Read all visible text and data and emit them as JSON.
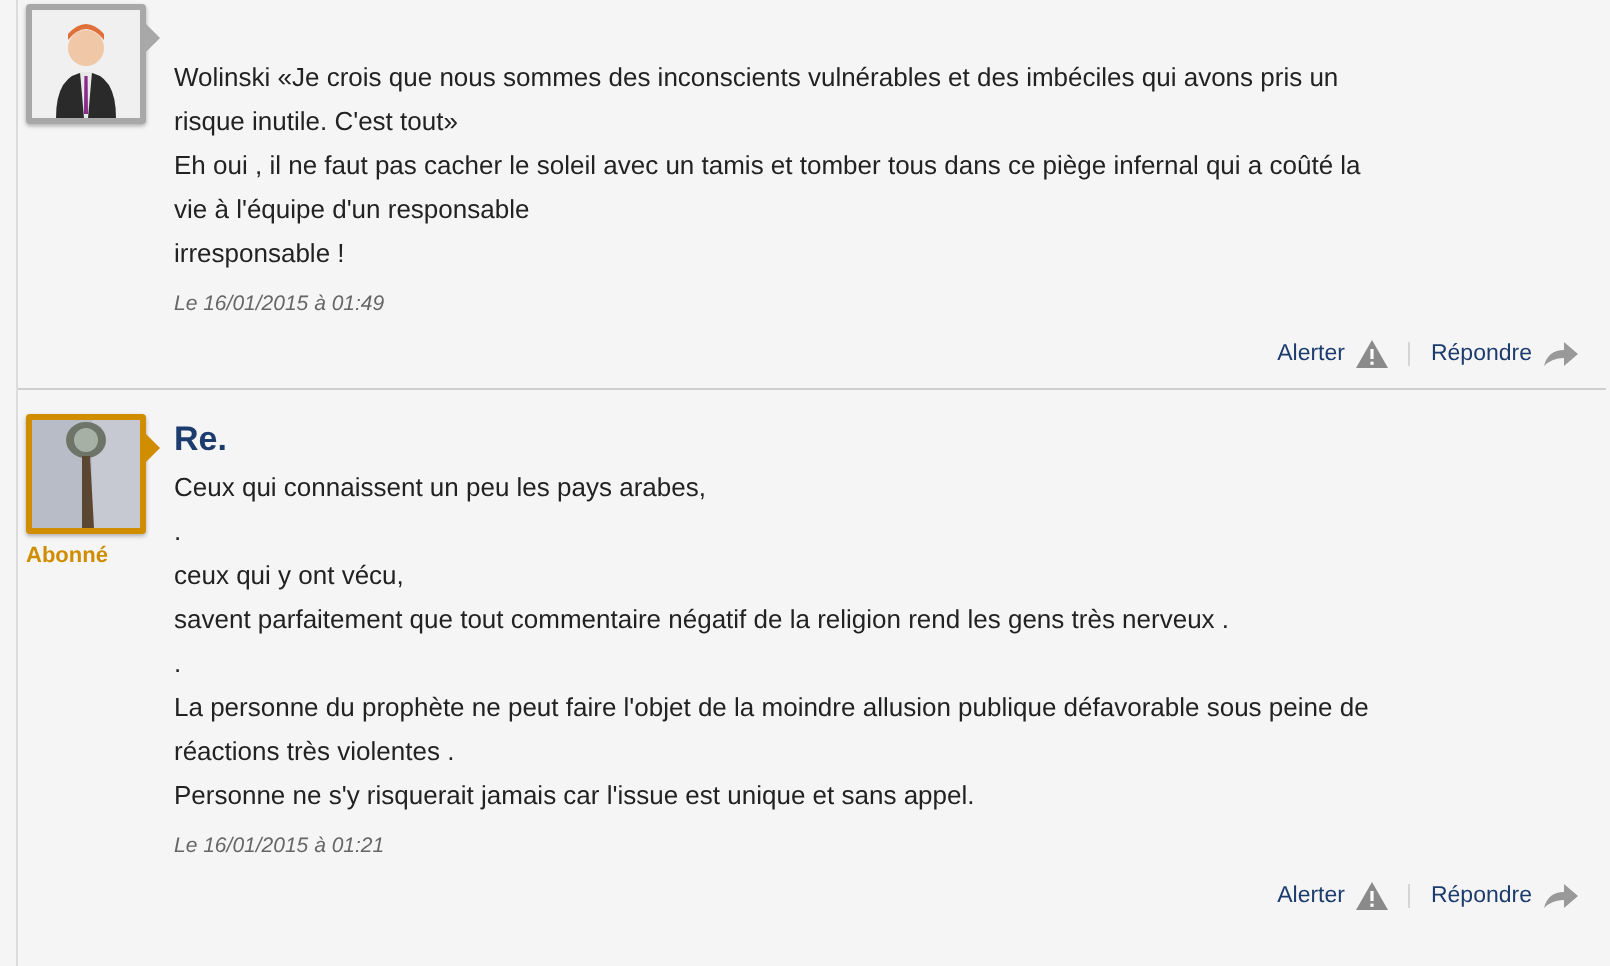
{
  "comments": [
    {
      "avatar": {
        "kind": "figure"
      },
      "subscriber": false,
      "lines": [
        "Wolinski «Je crois que nous sommes des inconscients vulnérables et des imbéciles qui avons pris un",
        "risque inutile. C'est tout»",
        "Eh oui , il ne faut pas cacher le soleil avec un tamis et tomber tous dans ce piège infernal qui a coûté la",
        "vie à l'équipe d'un responsable",
        "irresponsable !"
      ],
      "date": "Le 16/01/2015 à 01:49",
      "actions": [
        "Alerter",
        "Répondre"
      ]
    },
    {
      "subscriber": true,
      "badge": "Abonné",
      "author": "Re.",
      "lines": [
        "Ceux qui connaissent un peu les pays arabes,",
        ".",
        "ceux qui y ont vécu,",
        "savent parfaitement que tout commentaire négatif de la religion rend les gens très nerveux .",
        ".",
        "La personne du prophète ne peut faire l'objet de la moindre allusion publique défavorable sous peine de",
        "réactions très violentes .",
        "Personne ne s'y risquerait jamais car l'issue est unique et sans appel."
      ],
      "date": "Le 16/01/2015 à 01:21",
      "actions": [
        "Alerter",
        "Répondre"
      ]
    }
  ]
}
